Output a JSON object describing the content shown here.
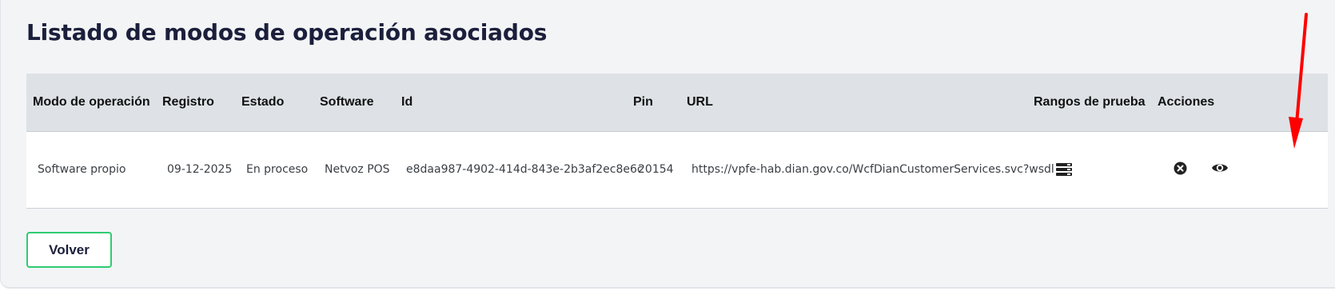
{
  "page": {
    "title": "Listado de modos de operación asociados"
  },
  "table": {
    "headers": {
      "modo": "Modo de operación",
      "registro": "Registro",
      "estado": "Estado",
      "software": "Software",
      "id": "Id",
      "pin": "Pin",
      "url": "URL",
      "rangos": "Rangos de prueba",
      "acciones": "Acciones"
    },
    "rows": [
      {
        "modo": "Software propio",
        "registro": "09-12-2025",
        "estado": "En proceso",
        "software": "Netvoz POS",
        "id": "e8daa987-4902-414d-843e-2b3af2ec8e6c",
        "pin": "20154",
        "url": "https://vpfe-hab.dian.gov.co/WcfDianCustomerServices.svc?wsdl",
        "rangos_icon": "list-icon",
        "actions": [
          "close-circle-icon",
          "eye-icon"
        ]
      }
    ]
  },
  "footer": {
    "back_label": "Volver"
  },
  "colors": {
    "page_bg": "#f3f4f6",
    "header_bg": "#dee2e6",
    "row_bg": "#ffffff",
    "accent_green": "#2ecc71",
    "annotation_red": "#ff0000",
    "title": "#1b1f3b"
  }
}
